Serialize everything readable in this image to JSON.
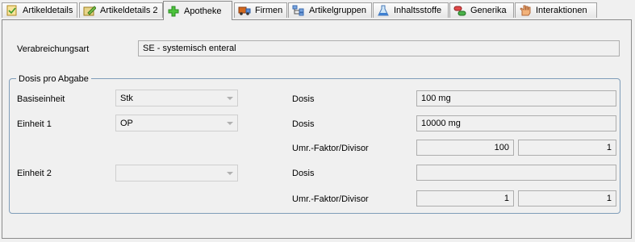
{
  "tabs": [
    {
      "label": "Artikeldetails",
      "icon": "document-check-icon"
    },
    {
      "label": "Artikeldetails 2",
      "icon": "pencil-icon"
    },
    {
      "label": "Apotheke",
      "icon": "green-cross-icon"
    },
    {
      "label": "Firmen",
      "icon": "truck-icon"
    },
    {
      "label": "Artikelgruppen",
      "icon": "grouping-icon"
    },
    {
      "label": "Inhaltsstoffe",
      "icon": "flask-icon"
    },
    {
      "label": "Generika",
      "icon": "pills-icon"
    },
    {
      "label": "Interaktionen",
      "icon": "hand-icon"
    }
  ],
  "verabreichungsart": {
    "label": "Verabreichungsart",
    "value": "SE - systemisch enteral"
  },
  "dosis_group": {
    "title": "Dosis pro Abgabe",
    "basiseinheit": {
      "label": "Basiseinheit",
      "value": "Stk",
      "dosis_label": "Dosis",
      "dosis_value": "100 mg"
    },
    "einheit1": {
      "label": "Einheit 1",
      "value": "OP",
      "dosis_label": "Dosis",
      "dosis_value": "10000 mg",
      "faktor_label": "Umr.-Faktor/Divisor",
      "faktor": "100",
      "divisor": "1"
    },
    "einheit2": {
      "label": "Einheit 2",
      "value": "",
      "dosis_label": "Dosis",
      "dosis_value": "",
      "faktor_label": "Umr.-Faktor/Divisor",
      "faktor": "1",
      "divisor": "1"
    }
  }
}
